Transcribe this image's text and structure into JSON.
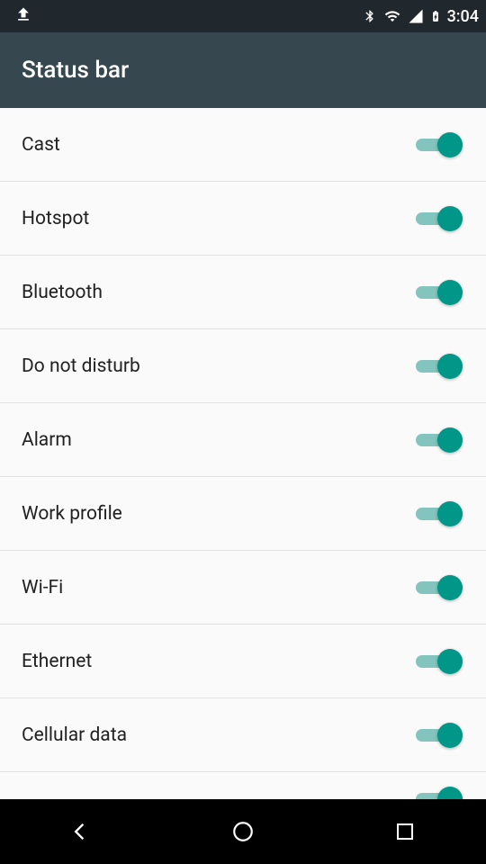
{
  "statusbar": {
    "time": "3:04"
  },
  "appbar": {
    "title": "Status bar"
  },
  "settings": [
    {
      "id": "cast",
      "label": "Cast",
      "on": true
    },
    {
      "id": "hotspot",
      "label": "Hotspot",
      "on": true
    },
    {
      "id": "bluetooth",
      "label": "Bluetooth",
      "on": true
    },
    {
      "id": "dnd",
      "label": "Do not disturb",
      "on": true
    },
    {
      "id": "alarm",
      "label": "Alarm",
      "on": true
    },
    {
      "id": "work-profile",
      "label": "Work profile",
      "on": true
    },
    {
      "id": "wifi",
      "label": "Wi-Fi",
      "on": true
    },
    {
      "id": "ethernet",
      "label": "Ethernet",
      "on": true
    },
    {
      "id": "cellular-data",
      "label": "Cellular data",
      "on": true
    }
  ],
  "colors": {
    "accent": "#009688",
    "appbar": "#36474f"
  }
}
